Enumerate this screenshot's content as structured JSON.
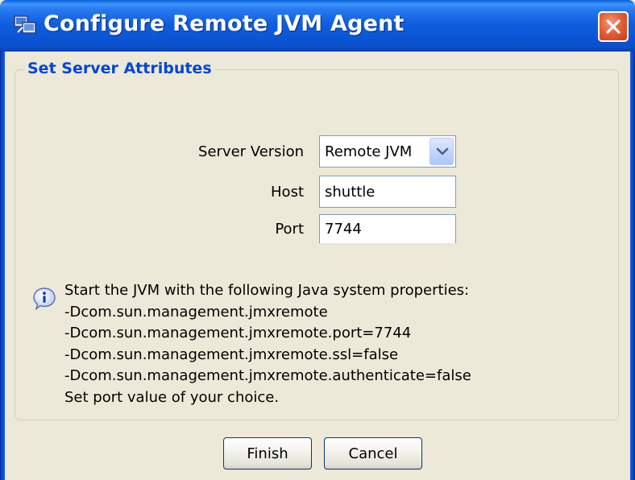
{
  "window": {
    "title": "Configure Remote JVM Agent",
    "icon": "jvm-agent-icon",
    "close_icon": "close-icon"
  },
  "group": {
    "title": "Set Server Attributes"
  },
  "form": {
    "server_version_label": "Server Version",
    "server_version_value": "Remote JVM",
    "host_label": "Host",
    "host_value": "shuttle",
    "port_label": "Port",
    "port_value": "7744"
  },
  "info": {
    "icon": "info-icon",
    "lines": [
      "Start the JVM with the following Java system properties:",
      "-Dcom.sun.management.jmxremote",
      "-Dcom.sun.management.jmxremote.port=7744",
      "-Dcom.sun.management.jmxremote.ssl=false",
      "-Dcom.sun.management.jmxremote.authenticate=false",
      "Set port value of your choice."
    ]
  },
  "buttons": {
    "finish": "Finish",
    "cancel": "Cancel"
  },
  "colors": {
    "titlebar": "#0a55d6",
    "group_title": "#0046d5",
    "dialog_bg": "#ece9d8",
    "close_button": "#e4603a"
  }
}
